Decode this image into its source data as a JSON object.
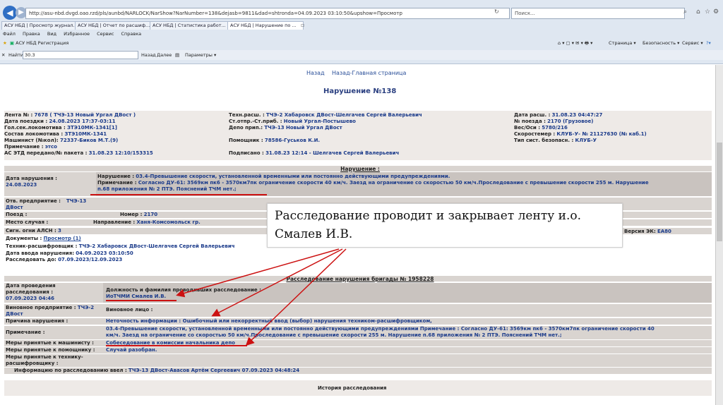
{
  "browser": {
    "address": "http://asu-nbd.dvgd.oao.rzd/pls/aunbd/NARLOCK/NarShow?NarNumber=138&dejasb=9811&dad=shtronda=04.09.2023 03:10:50&upshow=Просмотр",
    "search_placeholder": "Поиск...",
    "tabs": [
      "АСУ НБД | Просмотр журнал...",
      "АСУ НБД | Отчет по расшиф...",
      "АСУ НБД | Статистика работ...",
      "АСУ НБД | Нарушение по ..."
    ],
    "menu": [
      "Файл",
      "Правка",
      "Вид",
      "Избранное",
      "Сервис",
      "Справка"
    ],
    "favorite": "АСУ НБД Регистрация",
    "toolbar_right": [
      "Страница ▾",
      "Безопасность ▾",
      "Сервис ▾"
    ],
    "find_label": "Найти:",
    "find_value": "30.3",
    "find_prev": "Назад",
    "find_next": "Далее",
    "find_options": "Параметры ▾"
  },
  "nav": {
    "back": "Назад",
    "home": "Назад-Главная страница"
  },
  "title": "Нарушение №138",
  "info": {
    "col1": [
      {
        "l": "Лента № :",
        "v": "7678 ( ТЧЭ-13 Новый Ургал ДВост )"
      },
      {
        "l": "Дата поездки :",
        "v": "24.08.2023 17:37-03:11"
      },
      {
        "l": "Гол.сек.локомотива :",
        "v": "ЗТЭ10МК-1341[1]"
      },
      {
        "l": "Состав локомотива :",
        "v": "ЗТЭ10МК-1341"
      },
      {
        "l": "Машинист (№кол):",
        "v": "72337-Биков М.Т.(9)"
      },
      {
        "l": "Примечание :",
        "v": "этсо"
      },
      {
        "l": "АС ЭТД передано/№ пакета :",
        "v": "31.08.23 12:10/153315"
      }
    ],
    "col2": [
      {
        "l": "Техн.расш. :",
        "v": "ТЧЭ-2 Хабаровск ДВост-Шелгачев Сергей Валерьевич"
      },
      {
        "l": "Ст.отпр.-Ст.приб. :",
        "v": "Новый Ургал-Постышево"
      },
      {
        "l": "Депо прип.:",
        "v": "ТЧЭ-13 Новый Ургал ДВост"
      },
      {
        "l": "",
        "v": ""
      },
      {
        "l": "Помощник :",
        "v": "78586-Гуськов К.И."
      },
      {
        "l": "",
        "v": ""
      },
      {
        "l": "Подписано :",
        "v": "31.08.23 12:14 - Шелгачев Сергей Валерьевич"
      }
    ],
    "col3": [
      {
        "l": "Дата расш. :",
        "v": "31.08.23 04:47:27"
      },
      {
        "l": "№ поезда :",
        "v": "2170 (Грузовое)"
      },
      {
        "l": "Вес/Оси :",
        "v": "5780/216"
      },
      {
        "l": "Скоростемер :",
        "v": "КЛУБ-У- № 21127630 (№ каб.1)"
      },
      {
        "l": "Тип сист. безопасн. :",
        "v": "КЛУБ-У"
      }
    ]
  },
  "violation": {
    "header": "Нарушение :",
    "date_label": "Дата нарушения :",
    "date_value": "24.08.2023",
    "line1_label": "Нарушение :",
    "line1_value": "03.4-Превышение скорости, установленной временными или постоянно действующими предупреждениями.",
    "line2_label": "Примечание :",
    "line2_value": "Согласно ДУ-61: 3569км пк6 - 3570км7пк ограничение скорости 40 км/ч. Заезд на ограничение со скоростью 50 км/ч.Проследование с превышение скорости 255 м. Нарушение",
    "line3_value": "п.68 приложения № 2 ПТЭ. Пояснений ТЧМ нет.;",
    "resp_label": "Отв. предприятие :",
    "resp_value": "ТЧЭ-13",
    "resp_value2": "ДВост",
    "train_label": "Поезд :",
    "number_label": "Номер :",
    "number_value": "2170",
    "place_label": "Место случая :",
    "dir_label": "Направление :",
    "dir_value": "Ханя-Комсомольск гр.",
    "signal_label": "Сигн. огни АЛСН :",
    "signal_value": "3",
    "docs_label": "Документы :",
    "docs_link": "Просмотр (1)",
    "tech_label": "Техник-расшифровщик :",
    "tech_value": "ТЧЭ-2 Хабаровск ДВост-Шелгачев Сергей Валерьевич",
    "entry_label": "Дата ввода нарушения:",
    "entry_value": "04.09.2023 03:10:50",
    "investigate_label": "Расследовать до:",
    "investigate_value": "07.09.2023/12.09.2023",
    "right_frag1": "г",
    "right_frag2": "Версия ЭК:",
    "right_frag2_value": "EA80"
  },
  "callout": "Расследование проводит и закрывает ленту и.о. Смалев И.В.",
  "brigade": {
    "header": "Расследование нарушения бригады № 1958228",
    "date_label": "Дата проведения расследования :",
    "date_value": "07.09.2023  04:46",
    "pos_label": "Должность и фамилия проводивших расследование :",
    "pos_value": "ИоТЧМИ Смалев И.В.",
    "guilty_ent_label": "Виновное предприятие :",
    "guilty_ent_value": "ТЧЭ-2",
    "guilty_ent_value2": "ДВост",
    "guilty_person_label": "Виновное лицо :",
    "cause_label": "Причина нарушения :",
    "cause_value": "Неточность информации : Ошибочный или некорректный ввод (выбор) нарушения техником-расшифровщиком,",
    "note_label": "Примечание :",
    "note_value1": "03.4-Превышение скорости, установленной временными или постоянно действующими предупреждениями Примечание : Согласно ДУ-61: 3569км пк6 - 3570км7пк ограничение скорости 40",
    "note_value2": "км/ч. Заезд на ограничение со скоростью 50 км/ч.Проследование с превышение скорости 255 м. Нарушение п.68 приложения № 2 ПТЭ. Пояснений ТЧМ нет.;",
    "m1_label": "Меры принятые к машинисту :",
    "m1_value": "Собеседование в комиссии начальника депо",
    "m2_label": "Меры принятые к помощнику :",
    "m2_value": "Случай разобран.",
    "m3_label": "Меры принятые к технику-расшифровщику :",
    "entered_label": "Информацию по расследованию ввел :",
    "entered_value": "ТЧЭ-13 ДВост-Авасов Артём Сергеевич 07.09.2023 04:48:24",
    "history": "История расследования"
  },
  "colors": {
    "accent": "#2a4f99",
    "band": "#d9d4d0",
    "arrow": "#cc1111"
  }
}
